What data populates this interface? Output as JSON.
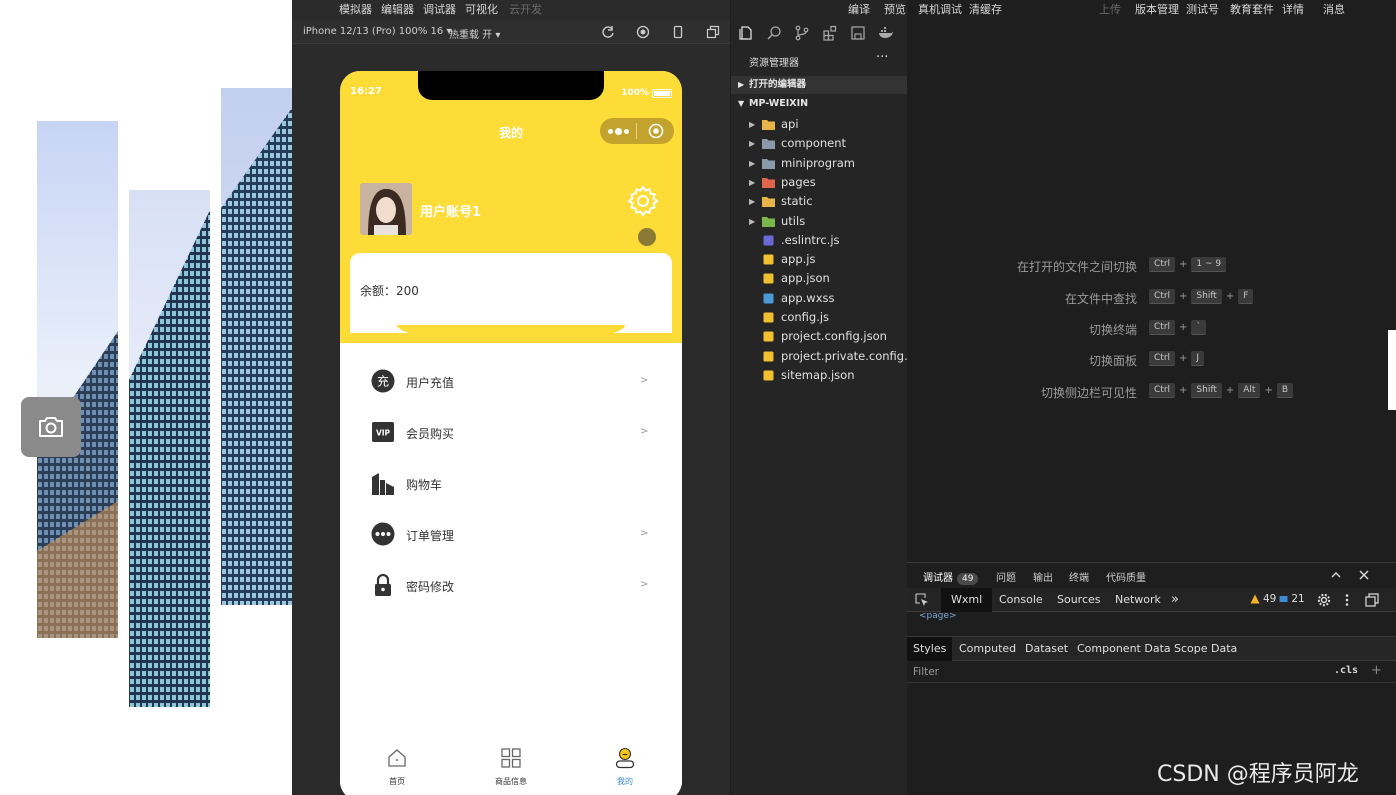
{
  "simulator": {
    "menu": [
      "模拟器",
      "编辑器",
      "调试器",
      "可视化",
      "云开发"
    ],
    "device": "iPhone 12/13 (Pro) 100% 16 ▾",
    "hot_reload": "热重载 开 ▾"
  },
  "top_menu_right": [
    "编译",
    "预览",
    "真机调试",
    "清缓存",
    "上传",
    "版本管理",
    "测试号",
    "教育套件",
    "详情",
    "消息"
  ],
  "phone": {
    "status_time": "16:27",
    "battery": "100%",
    "nav_title": "我的",
    "username": "用户账号1",
    "balance": "余额：200",
    "menu": [
      {
        "label": "用户充值",
        "arrow": ">",
        "icon": "recharge-icon"
      },
      {
        "label": "会员购买",
        "arrow": ">",
        "icon": "vip-icon"
      },
      {
        "label": "购物车",
        "arrow": "",
        "icon": "cart-icon"
      },
      {
        "label": "订单管理",
        "arrow": ">",
        "icon": "order-icon"
      },
      {
        "label": "密码修改",
        "arrow": ">",
        "icon": "lock-icon"
      }
    ],
    "tabs": [
      {
        "label": "首页",
        "icon": "home-icon"
      },
      {
        "label": "商品信息",
        "icon": "grid-icon"
      },
      {
        "label": "我的",
        "icon": "profile-icon"
      }
    ],
    "colors": {
      "accent": "#fedc37",
      "tab_active": "#3c8dd6"
    }
  },
  "explorer": {
    "title": "资源管理器",
    "more": "···",
    "open_editors": "打开的编辑器",
    "project": "MP-WEIXIN",
    "items": [
      {
        "name": "api",
        "type": "folder",
        "color": "#e8b44a"
      },
      {
        "name": "component",
        "type": "folder",
        "color": "#8a9aa8"
      },
      {
        "name": "miniprogram",
        "type": "folder",
        "color": "#8a9aa8"
      },
      {
        "name": "pages",
        "type": "folder",
        "color": "#e0654a"
      },
      {
        "name": "static",
        "type": "folder",
        "color": "#e8b44a"
      },
      {
        "name": "utils",
        "type": "folder",
        "color": "#7ab84a"
      },
      {
        "name": ".eslintrc.js",
        "type": "file",
        "color": "#6a6ad6"
      },
      {
        "name": "app.js",
        "type": "file",
        "color": "#f0c030"
      },
      {
        "name": "app.json",
        "type": "file",
        "color": "#f0c030"
      },
      {
        "name": "app.wxss",
        "type": "file",
        "color": "#4a9ad6"
      },
      {
        "name": "config.js",
        "type": "file",
        "color": "#f0c030"
      },
      {
        "name": "project.config.json",
        "type": "file",
        "color": "#f0c030"
      },
      {
        "name": "project.private.config.js...",
        "type": "file",
        "color": "#f0c030"
      },
      {
        "name": "sitemap.json",
        "type": "file",
        "color": "#f0c030"
      }
    ]
  },
  "shortcuts": [
    {
      "label": "在打开的文件之间切换",
      "keys": [
        "Ctrl",
        "1 ~ 9"
      ]
    },
    {
      "label": "在文件中查找",
      "keys": [
        "Ctrl",
        "Shift",
        "F"
      ]
    },
    {
      "label": "切换终端",
      "keys": [
        "Ctrl",
        "`"
      ]
    },
    {
      "label": "切换面板",
      "keys": [
        "Ctrl",
        "J"
      ]
    },
    {
      "label": "切换侧边栏可见性",
      "keys": [
        "Ctrl",
        "Shift",
        "Alt",
        "B"
      ]
    }
  ],
  "debug": {
    "tabs": [
      "调试器",
      "问题",
      "输出",
      "终端",
      "代码质量"
    ],
    "debugger_count": "49",
    "panel_tabs": [
      "Wxml",
      "Console",
      "Sources",
      "Network"
    ],
    "more": "»",
    "warnings": "49",
    "infos": "21",
    "node_fragment": "<page>",
    "styles_tabs": [
      "Styles",
      "Computed",
      "Dataset",
      "Component Data",
      "Scope Data"
    ],
    "filter_placeholder": "Filter",
    "cls": ".cls",
    "plus": "+"
  },
  "watermark": "CSDN @程序员阿龙"
}
